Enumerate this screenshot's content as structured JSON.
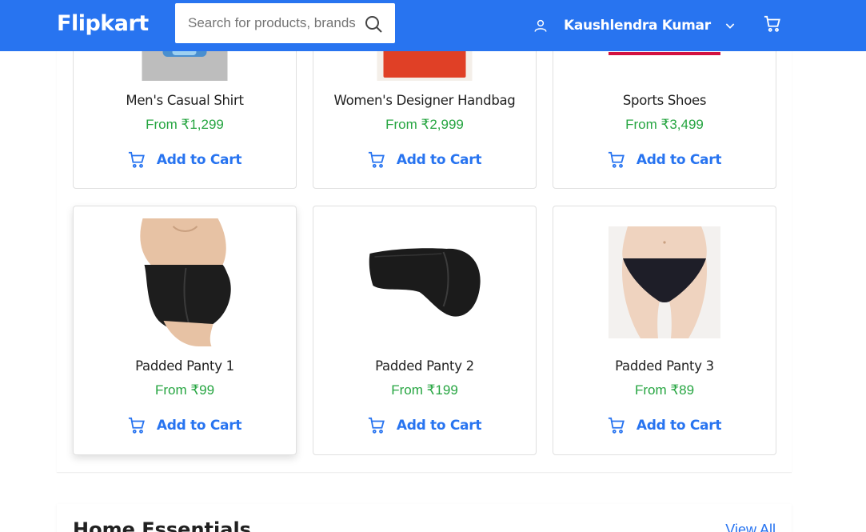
{
  "header": {
    "logo": "Flipkart",
    "search_placeholder": "Search for products, brands and more",
    "user_name": "Kaushlendra Kumar",
    "icons": {
      "search": "search-icon",
      "user": "user-icon",
      "chevron": "chevron-down-icon",
      "cart": "cart-icon"
    }
  },
  "products": [
    {
      "name": "Men's Casual Shirt",
      "price": "From ₹1,299",
      "cta": "Add to Cart"
    },
    {
      "name": "Women's Designer Handbag",
      "price": "From ₹2,999",
      "cta": "Add to Cart"
    },
    {
      "name": "Sports Shoes",
      "price": "From ₹3,499",
      "cta": "Add to Cart"
    },
    {
      "name": "Padded Panty 1",
      "price": "From ₹99",
      "cta": "Add to Cart"
    },
    {
      "name": "Padded Panty 2",
      "price": "From ₹199",
      "cta": "Add to Cart"
    },
    {
      "name": "Padded Panty 3",
      "price": "From ₹89",
      "cta": "Add to Cart"
    }
  ],
  "next_section": {
    "title": "Home Essentials",
    "view_all": "View All"
  },
  "colors": {
    "brand": "#2874f0",
    "price": "#26a541",
    "text": "#212121",
    "border": "#e0e0e0"
  }
}
